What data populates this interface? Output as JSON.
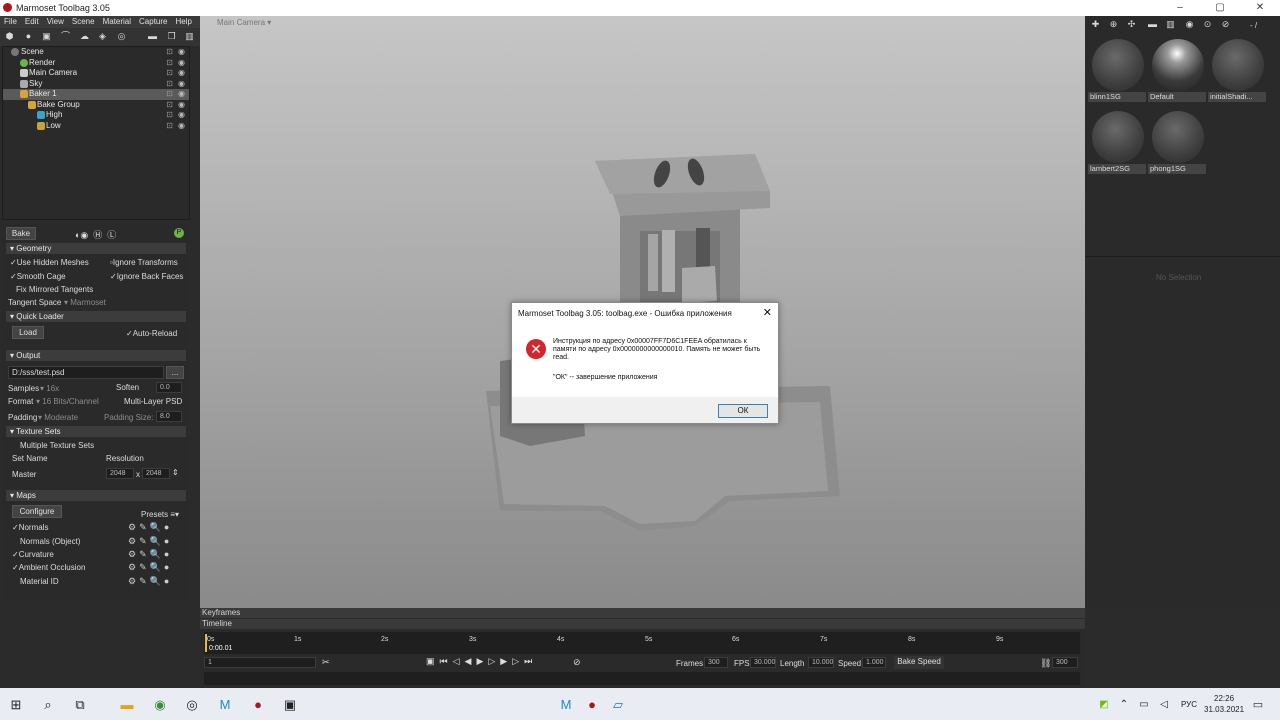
{
  "window": {
    "title": "Marmoset Toolbag 3.05"
  },
  "menu": [
    "File",
    "Edit",
    "View",
    "Scene",
    "Material",
    "Capture",
    "Help"
  ],
  "scene_tree": [
    {
      "label": "Scene",
      "indent": 0
    },
    {
      "label": "Render",
      "indent": 1
    },
    {
      "label": "Main Camera",
      "indent": 1
    },
    {
      "label": "Sky",
      "indent": 1
    },
    {
      "label": "Baker 1",
      "indent": 1,
      "selected": true
    },
    {
      "label": "Bake Group",
      "indent": 2
    },
    {
      "label": "High",
      "indent": 3
    },
    {
      "label": "Low",
      "indent": 3
    }
  ],
  "bake": {
    "bake_button": "Bake",
    "geometry": {
      "header": "Geometry",
      "use_hidden_meshes": "Use Hidden Meshes",
      "ignore_transforms": "Ignore Transforms",
      "smooth_cage": "Smooth Cage",
      "ignore_back_faces": "Ignore Back Faces",
      "fix_mirrored_tangents": "Fix Mirrored Tangents",
      "tangent_space_label": "Tangent Space",
      "tangent_space_value": "Marmoset"
    },
    "quick_loader": {
      "header": "Quick Loader",
      "load": "Load",
      "auto_reload": "Auto-Reload"
    },
    "output": {
      "header": "Output",
      "path": "D:/sss/test.psd",
      "browse": "...",
      "samples_label": "Samples",
      "samples_value": "16x",
      "soften": "Soften",
      "soften_value": "0.0",
      "format_label": "Format",
      "format_value": "16 Bits/Channel",
      "multi_layer": "Multi-Layer PSD",
      "padding_label": "Padding",
      "padding_value": "Moderate",
      "padding_size_label": "Padding Size:",
      "padding_size_value": "8.0"
    },
    "texture_sets": {
      "header": "Texture Sets",
      "multiple": "Multiple Texture Sets",
      "col_name": "Set Name",
      "col_res": "Resolution",
      "row_name": "Master",
      "res_w": "2048",
      "x": "x",
      "res_h": "2048"
    },
    "maps": {
      "header": "Maps",
      "configure": "Configure",
      "presets": "Presets",
      "items": [
        {
          "label": "Normals",
          "checked": true
        },
        {
          "label": "Normals (Object)",
          "checked": false
        },
        {
          "label": "Curvature",
          "checked": true
        },
        {
          "label": "Ambient Occlusion",
          "checked": true
        },
        {
          "label": "Material ID",
          "checked": false
        }
      ]
    }
  },
  "viewport": {
    "camera_label": "Main Camera"
  },
  "materials": [
    {
      "name": "blinn1SG"
    },
    {
      "name": "Default"
    },
    {
      "name": "initialShadi..."
    },
    {
      "name": "lambert2SG"
    },
    {
      "name": "phong1SG"
    }
  ],
  "material_toolbar_value": "- /",
  "no_selection": "No Selection",
  "timeline": {
    "keyframes": "Keyframes",
    "timeline": "Timeline",
    "ticks": [
      "0s",
      "1s",
      "2s",
      "3s",
      "4s",
      "5s",
      "6s",
      "7s",
      "8s",
      "9s"
    ],
    "current_time": "0:00.01",
    "frame_field": "1",
    "frames_label": "Frames",
    "frames_value": "300",
    "fps_label": "FPS",
    "fps_value": "30.000",
    "length_label": "Length",
    "length_value": "10.000",
    "speed_label": "Speed",
    "speed_value": "1.000",
    "bake_speed": "Bake Speed",
    "end_value": "300"
  },
  "dialog": {
    "title": "Marmoset Toolbag 3.05: toolbag.exe - Ошибка приложения",
    "message": "Инструкция по адресу 0x00007FF7D6C1FEEA обратилась к памяти по адресу 0x0000000000000010. Память не может быть read.",
    "hint": "\"ОК\" -- завершение приложения",
    "ok": "ОК"
  },
  "taskbar": {
    "lang": "РУС",
    "time": "22:26",
    "date": "31.03.2021"
  }
}
